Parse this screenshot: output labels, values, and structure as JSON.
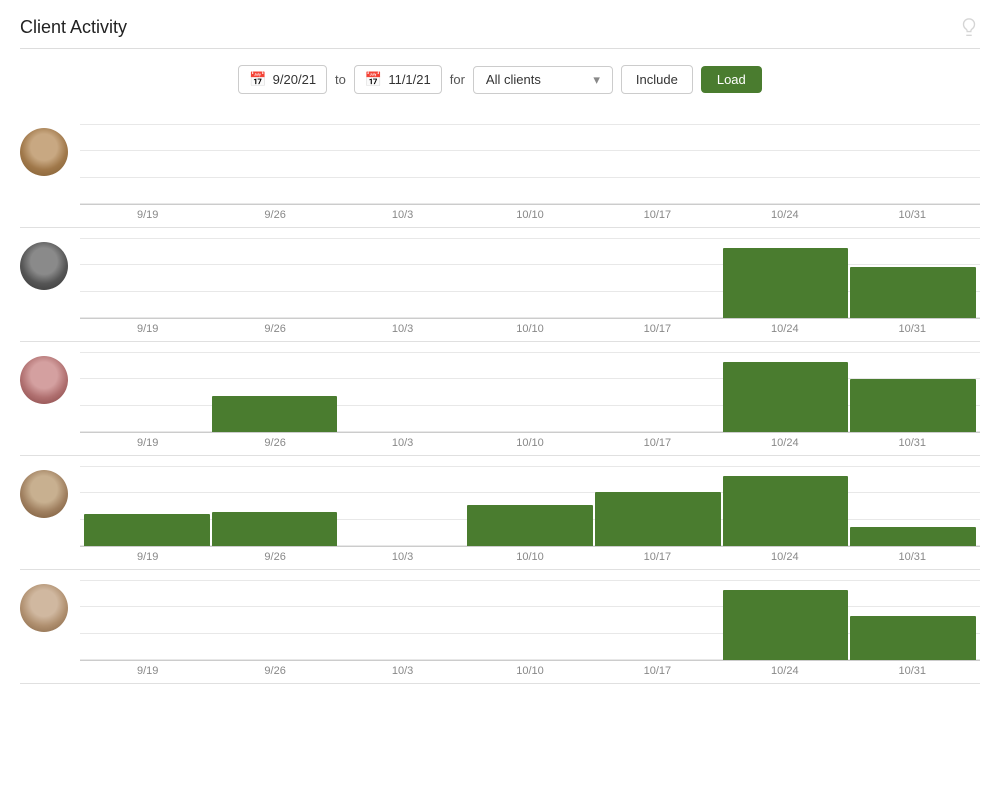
{
  "page": {
    "title": "Client Activity"
  },
  "toolbar": {
    "date_from": "9/20/21",
    "date_to": "11/1/21",
    "for_label": "for",
    "to_label": "to",
    "client_select": "All clients",
    "include_label": "Include",
    "load_label": "Load"
  },
  "x_labels": [
    "9/19",
    "9/26",
    "10/3",
    "10/10",
    "10/17",
    "10/24",
    "10/31"
  ],
  "clients": [
    {
      "id": "client-1",
      "avatar_class": "av1",
      "bars": [
        0,
        0,
        0,
        0,
        0,
        0,
        0
      ]
    },
    {
      "id": "client-2",
      "avatar_class": "av2",
      "bars": [
        0,
        0,
        0,
        0,
        0,
        52,
        38
      ]
    },
    {
      "id": "client-3",
      "avatar_class": "av3",
      "bars": [
        0,
        28,
        0,
        0,
        0,
        55,
        42
      ]
    },
    {
      "id": "client-4",
      "avatar_class": "av4",
      "bars": [
        30,
        32,
        0,
        38,
        50,
        65,
        18
      ]
    },
    {
      "id": "client-5",
      "avatar_class": "av5",
      "bars": [
        0,
        0,
        0,
        0,
        0,
        45,
        28
      ]
    }
  ]
}
